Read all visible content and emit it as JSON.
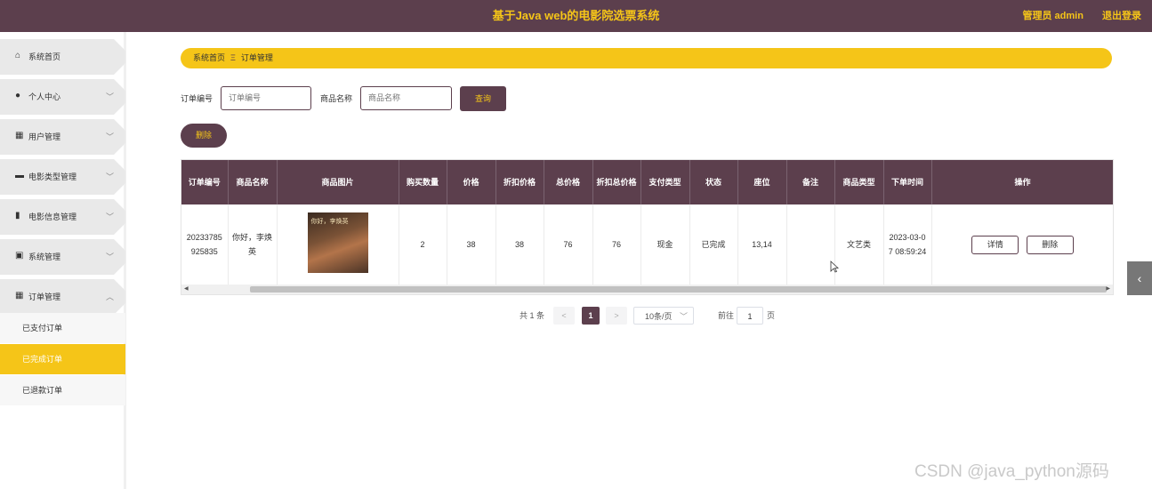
{
  "header": {
    "title": "基于Java web的电影院选票系统",
    "user": "管理员 admin",
    "logout": "退出登录"
  },
  "sidebar": {
    "items": [
      {
        "label": "系统首页",
        "icon": "home-icon",
        "chevron": ""
      },
      {
        "label": "个人中心",
        "icon": "user-icon",
        "chevron": "﹀"
      },
      {
        "label": "用户管理",
        "icon": "grid-icon",
        "chevron": "﹀"
      },
      {
        "label": "电影类型管理",
        "icon": "briefcase-icon",
        "chevron": "﹀"
      },
      {
        "label": "电影信息管理",
        "icon": "bar-chart-icon",
        "chevron": "﹀"
      },
      {
        "label": "系统管理",
        "icon": "clipboard-icon",
        "chevron": "﹀"
      },
      {
        "label": "订单管理",
        "icon": "grid-icon",
        "chevron": "︿"
      }
    ],
    "subitems": [
      {
        "label": "已支付订单",
        "active": false
      },
      {
        "label": "已完成订单",
        "active": true
      },
      {
        "label": "已退款订单",
        "active": false
      }
    ]
  },
  "breadcrumb": {
    "home": "系统首页",
    "separator": "Ξ",
    "current": "订单管理"
  },
  "search": {
    "order_label": "订单编号",
    "order_placeholder": "订单编号",
    "product_label": "商品名称",
    "product_placeholder": "商品名称",
    "search_button": "查询"
  },
  "delete_button": "删除",
  "table": {
    "headers": [
      "订单编号",
      "商品名称",
      "商品图片",
      "购买数量",
      "价格",
      "折扣价格",
      "总价格",
      "折扣总价格",
      "支付类型",
      "状态",
      "座位",
      "备注",
      "商品类型",
      "下单时间",
      "操作"
    ],
    "rows": [
      {
        "order_no": "20233785925835",
        "product_name": "你好，李焕英",
        "poster_title": "你好，李焕英",
        "quantity": "2",
        "price": "38",
        "discount_price": "38",
        "total": "76",
        "discount_total": "76",
        "pay_type": "现金",
        "status": "已完成",
        "seat": "13,14",
        "remark": "",
        "product_type": "文艺类",
        "order_time": "2023-03-07 08:59:24",
        "detail_button": "详情",
        "delete_button": "删除"
      }
    ]
  },
  "pagination": {
    "total": "共 1 条",
    "prev": "<",
    "current_page": "1",
    "next": ">",
    "page_size": "10条/页",
    "goto_label": "前往",
    "goto_value": "1",
    "goto_suffix": "页"
  },
  "watermark": "CSDN @java_python源码",
  "colors": {
    "primary": "#5c3f4d",
    "accent": "#f5c518"
  }
}
